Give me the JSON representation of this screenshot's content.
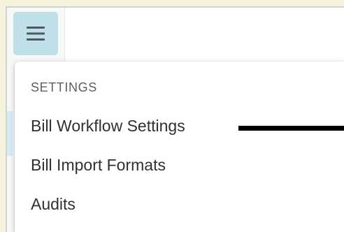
{
  "toggle": {
    "icon": "hamburger-menu-icon",
    "color": "#bfe0e9"
  },
  "menu": {
    "heading": "SETTINGS",
    "items": [
      {
        "label": "Bill Workflow Settings"
      },
      {
        "label": "Bill Import Formats"
      },
      {
        "label": "Audits"
      }
    ]
  },
  "colors": {
    "page_background": "#f6f3dd",
    "toggle_background": "#bfe0e9",
    "annotation_arrow": "#000000"
  }
}
